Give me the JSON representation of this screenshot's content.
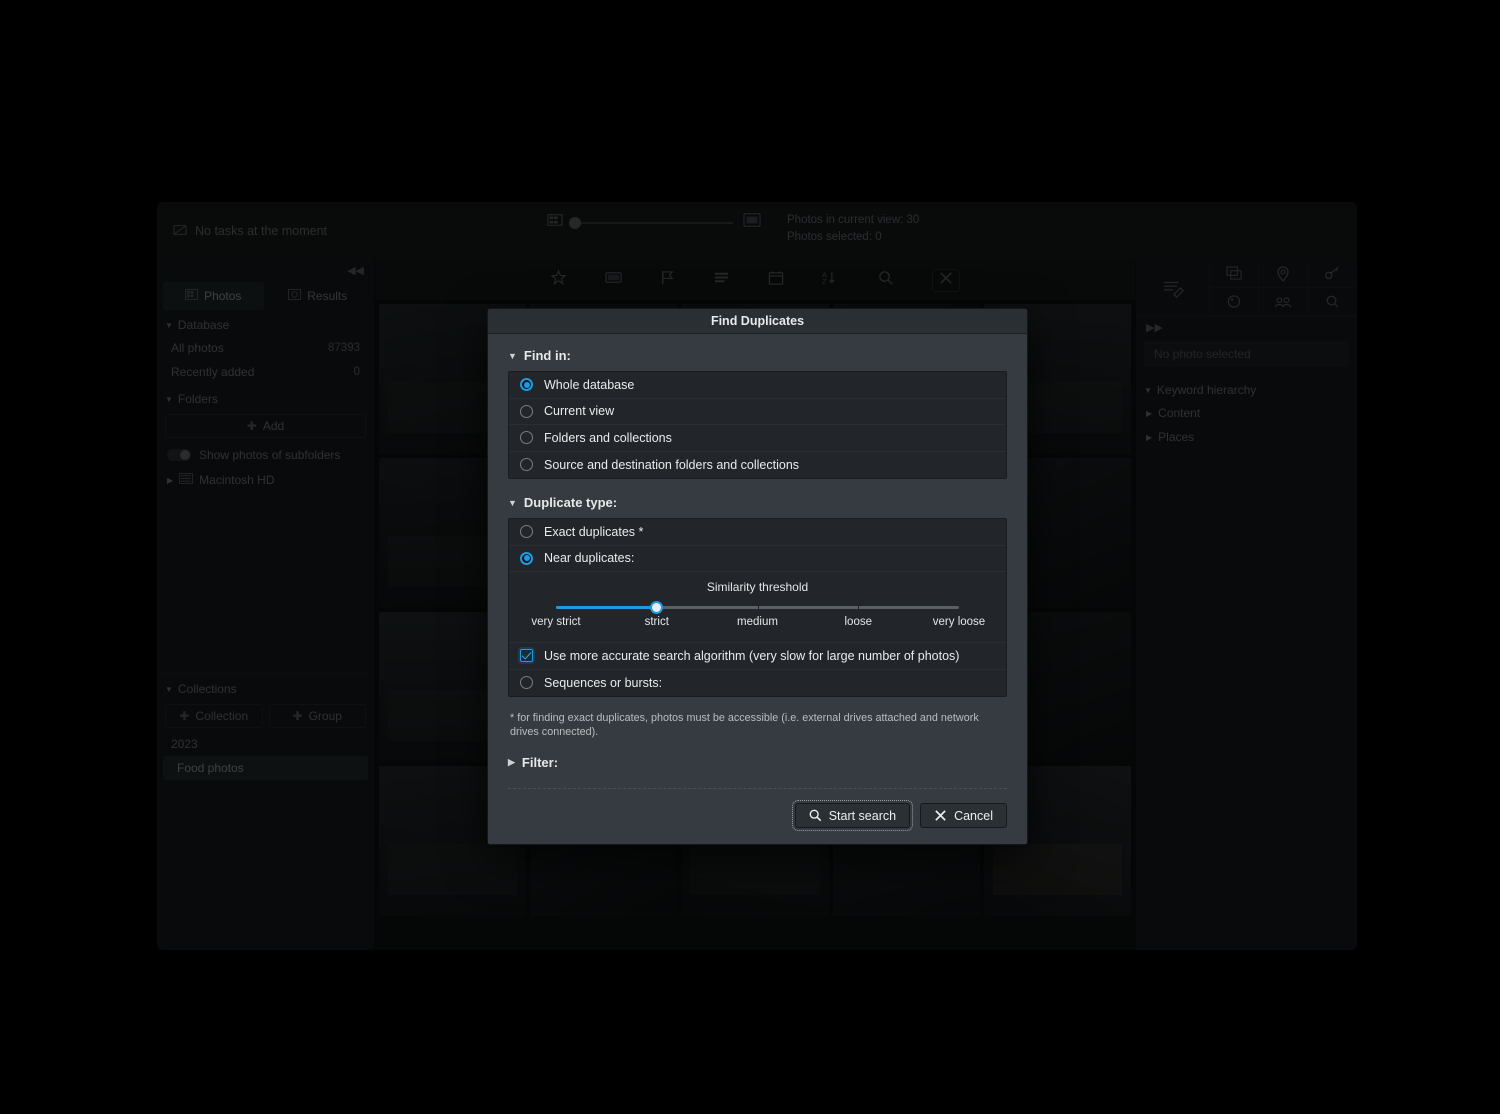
{
  "app": {
    "task_status": "No tasks at the moment",
    "task_icon": "task-icon",
    "counts": {
      "photos_in_view": "Photos in current view: 30",
      "photos_selected": "Photos selected: 0"
    },
    "zoom_small_icon": "thumbnail-small-icon",
    "zoom_large_icon": "thumbnail-large-icon",
    "sidebar_left": {
      "collapse_icon": "collapse-left-icon",
      "tabs": [
        {
          "label": "Photos",
          "icon": "photos-icon",
          "active": true
        },
        {
          "label": "Results",
          "icon": "results-icon",
          "active": false
        }
      ],
      "database": {
        "title": "Database",
        "items": [
          {
            "label": "All photos",
            "count": "87393"
          },
          {
            "label": "Recently added",
            "count": "0"
          }
        ]
      },
      "folders": {
        "title": "Folders",
        "add_label": "Add",
        "add_icon": "plus-icon",
        "subfolders_label": "Show photos of subfolders",
        "tree": [
          {
            "label": "Macintosh HD",
            "icon": "drive-icon"
          }
        ]
      },
      "collections": {
        "title": "Collections",
        "new_collection_label": "Collection",
        "new_group_label": "Group",
        "items": [
          {
            "label": "2023",
            "selected": false
          },
          {
            "label": "Food photos",
            "selected": true
          }
        ]
      }
    },
    "toolbar": {
      "icons": [
        "star-rating-icon",
        "color-label-icon",
        "flag-icon",
        "list-view-icon",
        "calendar-icon",
        "sort-az-icon",
        "search-icon"
      ],
      "close_icon": "close-icon"
    },
    "sidebar_right": {
      "collapse_icon": "collapse-right-icon",
      "edit_icon": "metadata-edit-icon",
      "icons": [
        "duplicate-photos-icon",
        "map-pin-icon",
        "key-icon",
        "palette-icon",
        "people-icon",
        "info-icon"
      ],
      "search_placeholder": "No photo selected",
      "keyword_section": {
        "title": "Keyword hierarchy",
        "items": [
          "Content",
          "Places"
        ]
      }
    }
  },
  "dialog": {
    "title": "Find Duplicates",
    "find_in": {
      "title": "Find in:",
      "expanded": true,
      "options": [
        {
          "label": "Whole database",
          "checked": true
        },
        {
          "label": "Current view",
          "checked": false
        },
        {
          "label": "Folders and collections",
          "checked": false
        },
        {
          "label": "Source and destination folders and collections",
          "checked": false
        }
      ]
    },
    "duplicate_type": {
      "title": "Duplicate type:",
      "expanded": true,
      "exact": {
        "label": "Exact duplicates *",
        "checked": false
      },
      "near": {
        "label": "Near duplicates:",
        "checked": true
      },
      "slider": {
        "title": "Similarity threshold",
        "labels": [
          "very strict",
          "strict",
          "medium",
          "loose",
          "very loose"
        ],
        "value_index": 1,
        "value_label": "strict",
        "fill_percent": 25
      },
      "accurate": {
        "label": "Use more accurate search algorithm (very slow for large number of photos)",
        "checked": true
      },
      "sequences": {
        "label": "Sequences or bursts:",
        "checked": false
      }
    },
    "footnote": "* for finding exact duplicates, photos must be accessible (i.e. external drives attached and network drives connected).",
    "filter": {
      "title": "Filter:",
      "expanded": false
    },
    "buttons": {
      "start": {
        "label": "Start search",
        "icon": "search-icon",
        "focused": true
      },
      "cancel": {
        "label": "Cancel",
        "icon": "close-x-icon"
      }
    }
  },
  "colors": {
    "accent": "#1e9ae0",
    "dialog_bg": "#353b40",
    "dialog_title_bg": "#2a2f34",
    "panel_bg": "#22262a",
    "text": "#e9ebed"
  }
}
